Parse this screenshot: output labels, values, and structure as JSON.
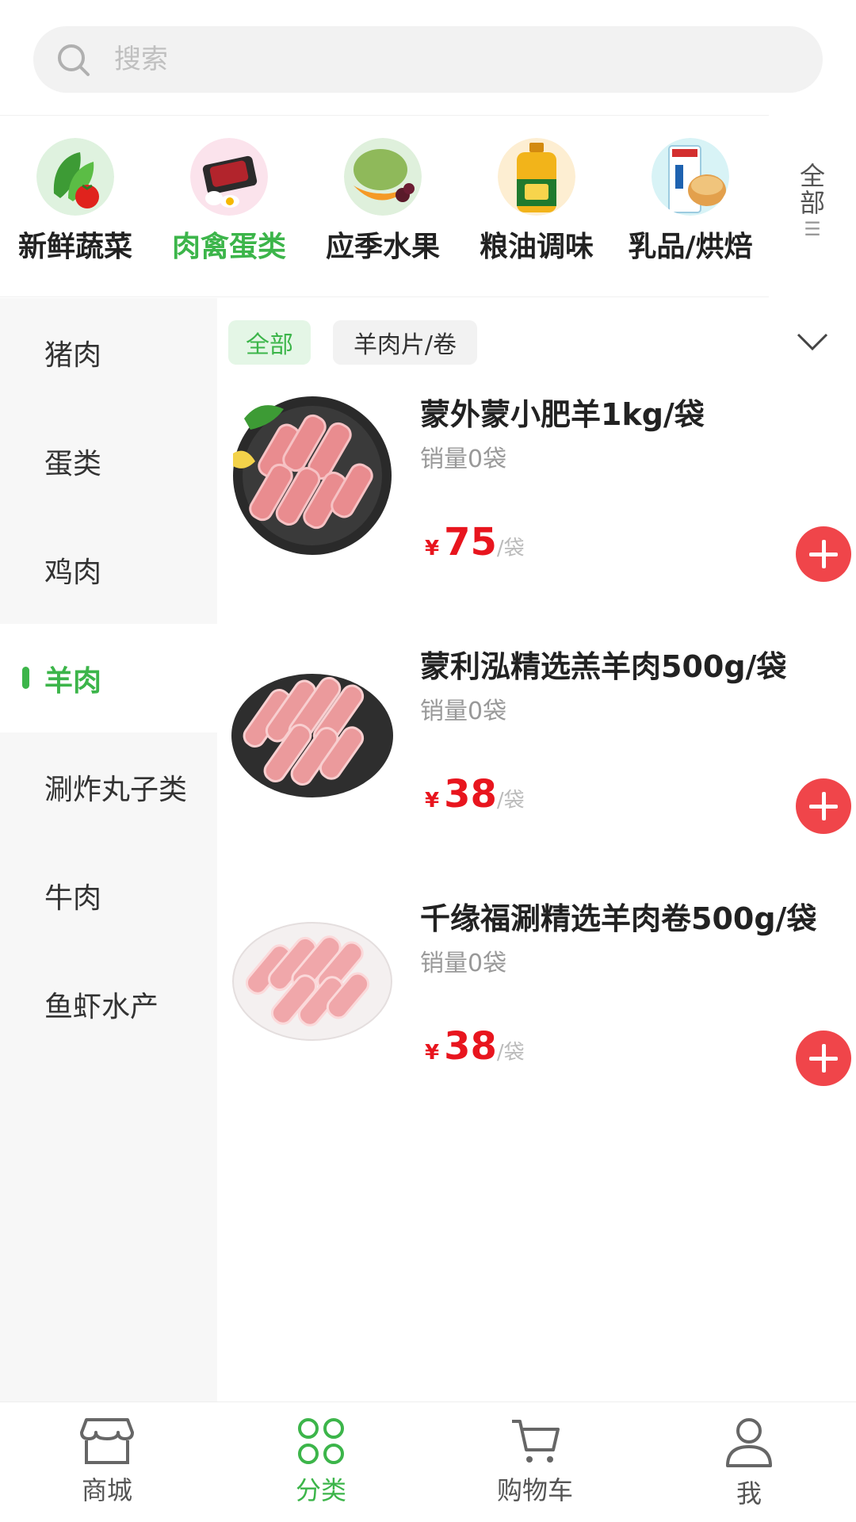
{
  "search": {
    "placeholder": "搜索"
  },
  "categories": [
    {
      "label": "新鲜蔬菜",
      "icon": "vegetables-icon",
      "active": false
    },
    {
      "label": "肉禽蛋类",
      "icon": "meat-eggs-icon",
      "active": true
    },
    {
      "label": "应季水果",
      "icon": "fruit-icon",
      "active": false
    },
    {
      "label": "粮油调味",
      "icon": "oil-icon",
      "active": false
    },
    {
      "label": "乳品/烘焙",
      "icon": "dairy-bakery-icon",
      "active": false
    }
  ],
  "categories_all": {
    "label": "全部",
    "icon": "menu-icon"
  },
  "sidebar": {
    "items": [
      {
        "label": "猪肉"
      },
      {
        "label": "蛋类"
      },
      {
        "label": "鸡肉"
      },
      {
        "label": "羊肉",
        "active": true
      },
      {
        "label": "涮炸丸子类"
      },
      {
        "label": "牛肉"
      },
      {
        "label": "鱼虾水产"
      }
    ]
  },
  "filters": {
    "all": "全部",
    "lamb_slices": "羊肉片/卷",
    "expand_icon": "chevron-down-icon"
  },
  "products": [
    {
      "name": "蒙外蒙小肥羊1kg/袋",
      "sales": "销量0袋",
      "currency": "¥",
      "price": "75",
      "unit": "/袋"
    },
    {
      "name": "蒙利泓精选羔羊肉500g/袋",
      "sales": "销量0袋",
      "currency": "¥",
      "price": "38",
      "unit": "/袋"
    },
    {
      "name": "千缘福涮精选羊肉卷500g/袋",
      "sales": "销量0袋",
      "currency": "¥",
      "price": "38",
      "unit": "/袋"
    }
  ],
  "tabbar": {
    "items": [
      {
        "label": "商城",
        "icon": "store-icon"
      },
      {
        "label": "分类",
        "icon": "category-icon",
        "active": true
      },
      {
        "label": "购物车",
        "icon": "cart-icon"
      },
      {
        "label": "我",
        "icon": "user-icon"
      }
    ]
  },
  "colors": {
    "accent": "#3cb54a",
    "price": "#e8151e",
    "add_button": "#f0454a"
  }
}
